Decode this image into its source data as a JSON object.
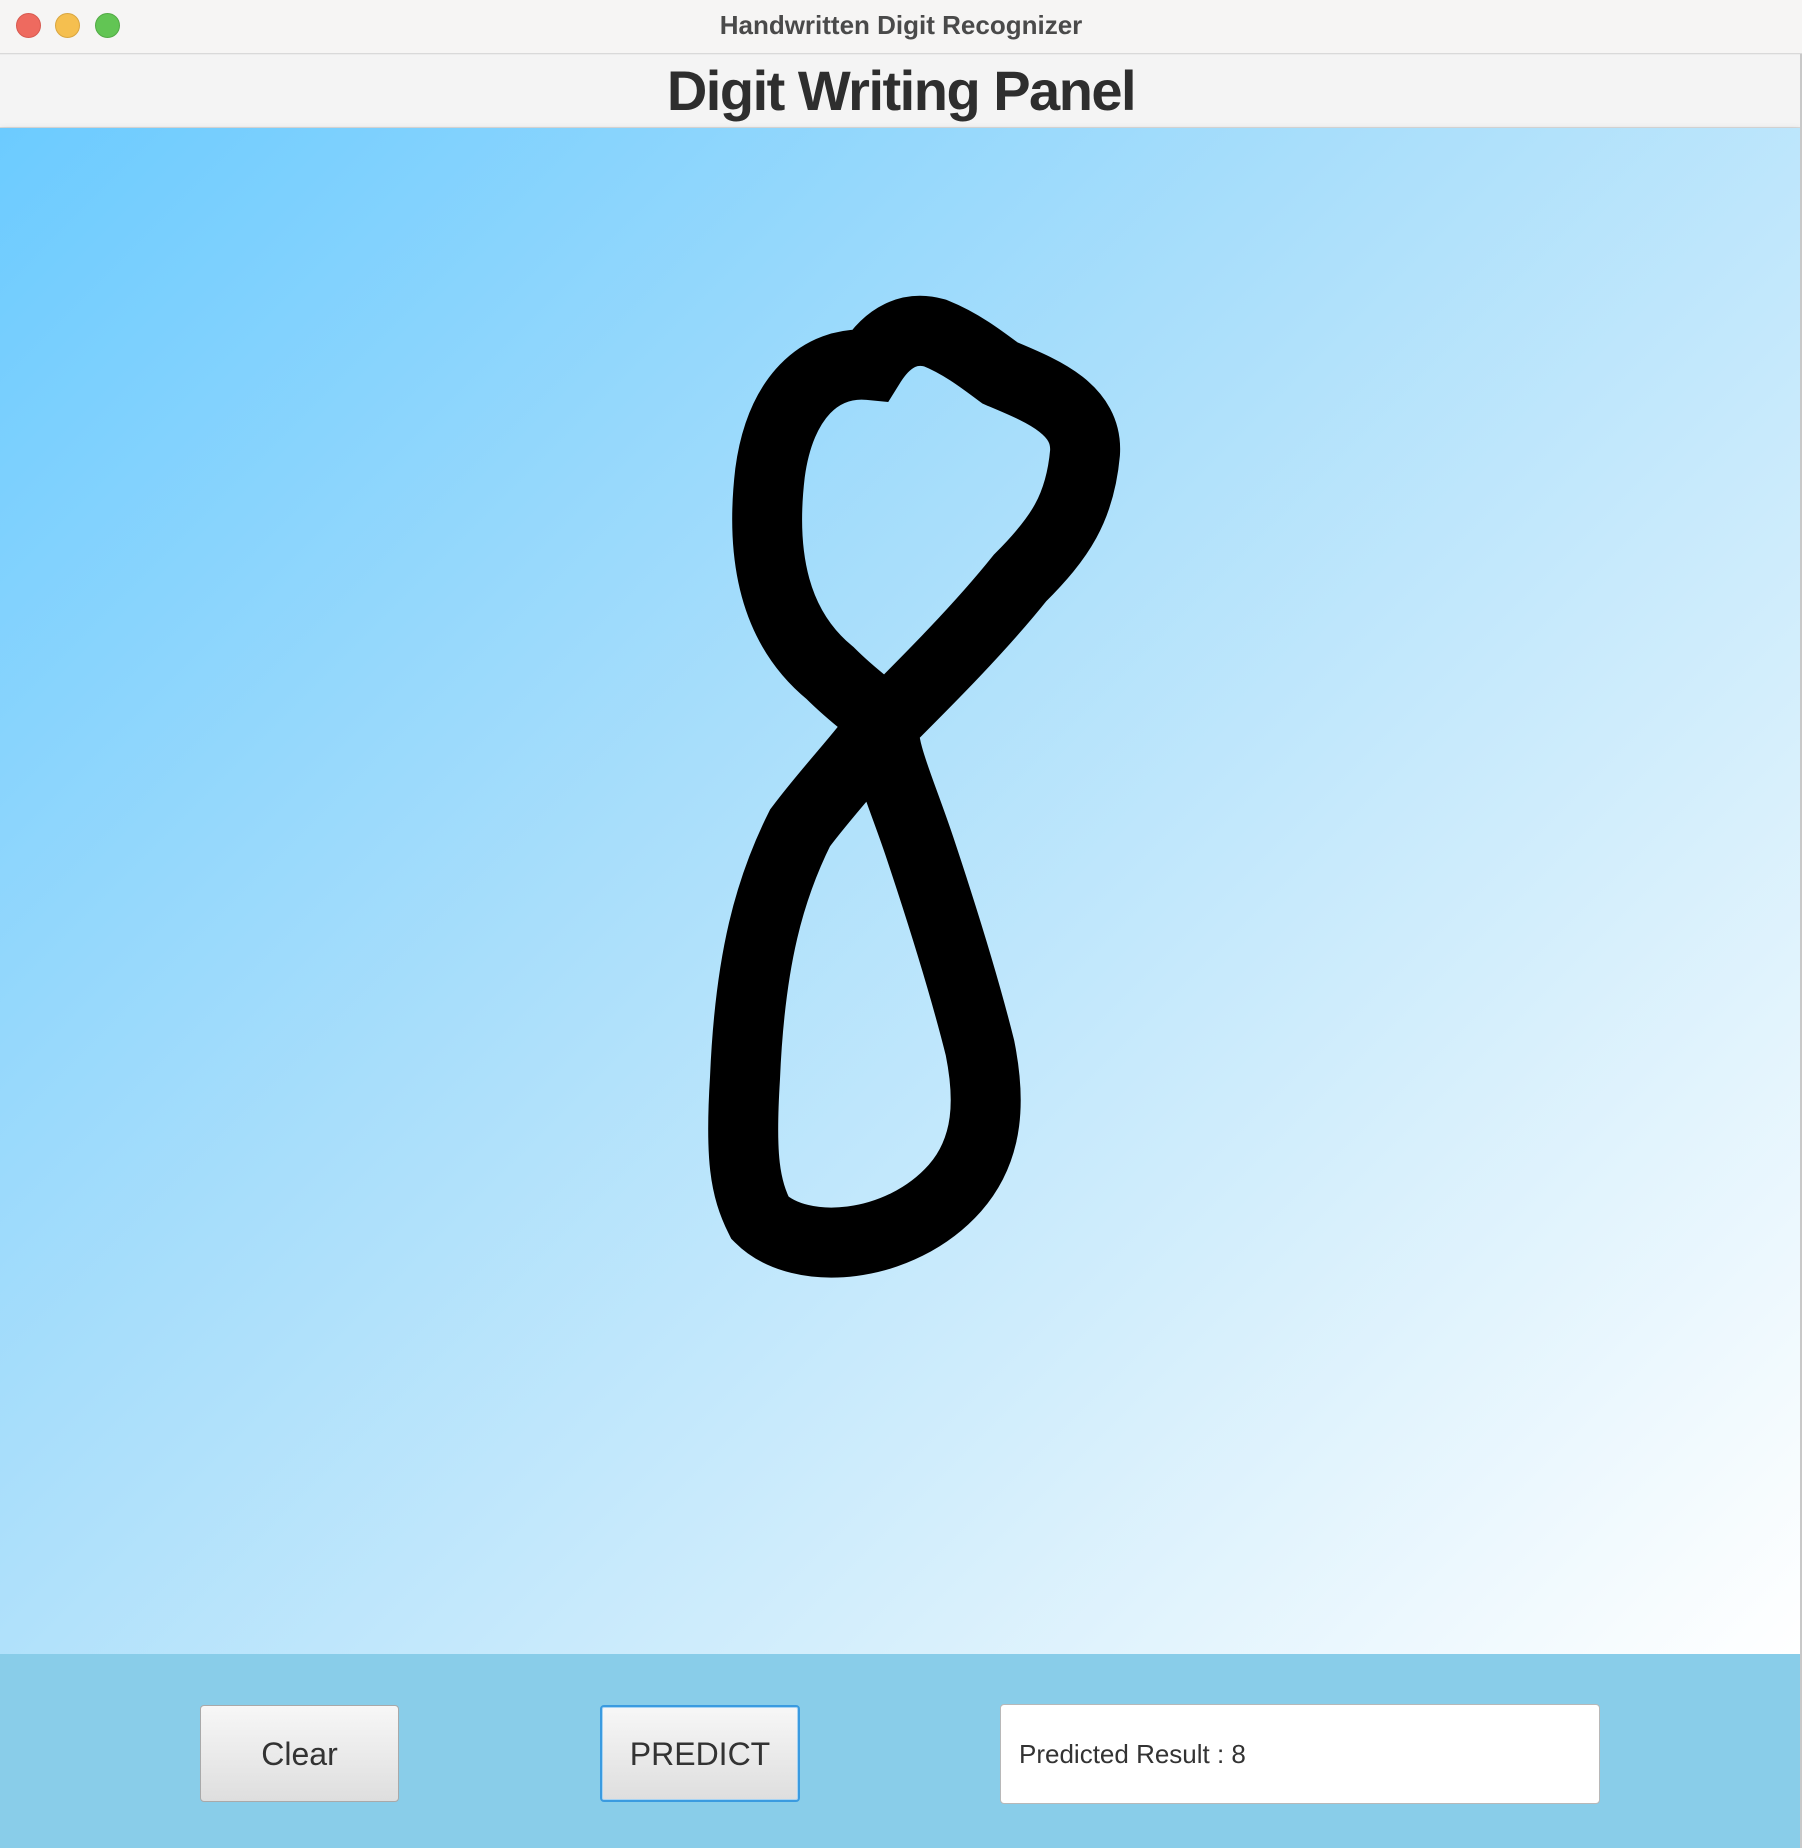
{
  "window": {
    "title": "Handwritten Digit Recognizer"
  },
  "header": {
    "title": "Digit Writing Panel"
  },
  "canvas": {
    "drawn_digit": "8",
    "ink_color": "#000000",
    "gradient_colors": [
      "#6ccbff",
      "#ffffff"
    ]
  },
  "toolbar": {
    "clear_label": "Clear",
    "predict_label": "PREDICT",
    "result_text": "Predicted Result : 8"
  },
  "colors": {
    "toolbar_bg": "#89cde9",
    "predict_focus": "#3a9be0",
    "close": "#ee6a5f",
    "minimize": "#f5bf4f",
    "maximize": "#62c554"
  }
}
